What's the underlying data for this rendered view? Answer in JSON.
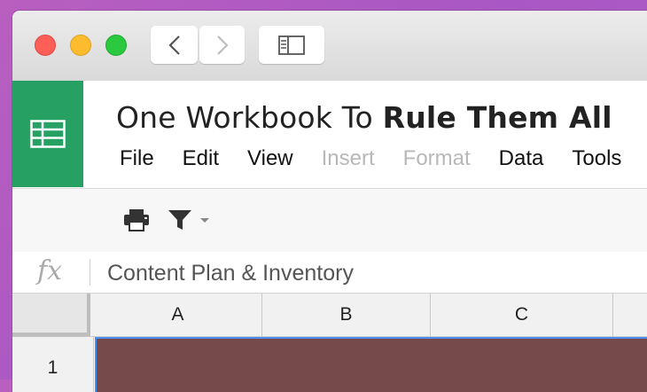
{
  "window": {
    "controls": [
      "close",
      "minimize",
      "zoom"
    ],
    "nav": {
      "back_icon": "chevron-left-icon",
      "forward_icon": "chevron-right-icon",
      "sidebar_icon": "sidebar-icon"
    }
  },
  "doc": {
    "title_prefix": "One Workbook To ",
    "title_bold": "Rule Them All"
  },
  "menu": {
    "items": [
      {
        "label": "File",
        "enabled": true
      },
      {
        "label": "Edit",
        "enabled": true
      },
      {
        "label": "View",
        "enabled": true
      },
      {
        "label": "Insert",
        "enabled": false
      },
      {
        "label": "Format",
        "enabled": false
      },
      {
        "label": "Data",
        "enabled": true
      },
      {
        "label": "Tools",
        "enabled": true
      }
    ]
  },
  "toolbar": {
    "icons": [
      "print-icon",
      "filter-icon",
      "dropdown-caret-icon"
    ]
  },
  "formula_bar": {
    "fx_label": "fx",
    "value": "Content Plan & Inventory"
  },
  "grid": {
    "columns": [
      "A",
      "B",
      "C"
    ],
    "rows": [
      "1"
    ],
    "selected_cell_fill": "#76494a",
    "selection_border": "#4a8cf0"
  },
  "colors": {
    "sheets_green": "#27a163"
  }
}
